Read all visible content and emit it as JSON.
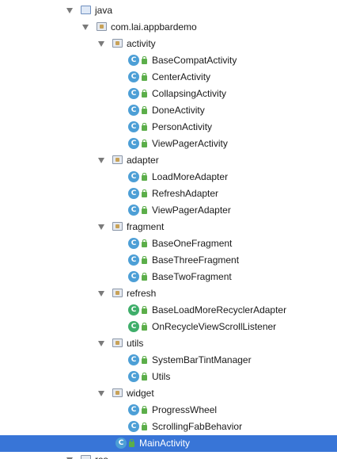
{
  "tree": [
    {
      "label": "java",
      "kind": "source-folder",
      "level": 0,
      "expanded": true
    },
    {
      "label": "com.lai.appbardemo",
      "kind": "package",
      "level": 1,
      "expanded": true
    },
    {
      "label": "activity",
      "kind": "package",
      "level": 2,
      "expanded": true
    },
    {
      "label": "BaseCompatActivity",
      "kind": "class",
      "level": 3
    },
    {
      "label": "CenterActivity",
      "kind": "class",
      "level": 3
    },
    {
      "label": "CollapsingActivity",
      "kind": "class",
      "level": 3
    },
    {
      "label": "DoneActivity",
      "kind": "class",
      "level": 3
    },
    {
      "label": "PersonActivity",
      "kind": "class",
      "level": 3
    },
    {
      "label": "ViewPagerActivity",
      "kind": "class",
      "level": 3
    },
    {
      "label": "adapter",
      "kind": "package",
      "level": 2,
      "expanded": true
    },
    {
      "label": "LoadMoreAdapter",
      "kind": "class",
      "level": 3
    },
    {
      "label": "RefreshAdapter",
      "kind": "class",
      "level": 3
    },
    {
      "label": "ViewPagerAdapter",
      "kind": "class",
      "level": 3
    },
    {
      "label": "fragment",
      "kind": "package",
      "level": 2,
      "expanded": true
    },
    {
      "label": "BaseOneFragment",
      "kind": "class",
      "level": 3
    },
    {
      "label": "BaseThreeFragment",
      "kind": "class",
      "level": 3
    },
    {
      "label": "BaseTwoFragment",
      "kind": "class",
      "level": 3
    },
    {
      "label": "refresh",
      "kind": "package",
      "level": 2,
      "expanded": true
    },
    {
      "label": "BaseLoadMoreRecyclerAdapter",
      "kind": "class-green",
      "level": 3
    },
    {
      "label": "OnRecycleViewScrollListener",
      "kind": "class-green",
      "level": 3
    },
    {
      "label": "utils",
      "kind": "package",
      "level": 2,
      "expanded": true
    },
    {
      "label": "SystemBarTintManager",
      "kind": "class",
      "level": 3
    },
    {
      "label": "Utils",
      "kind": "class",
      "level": 3
    },
    {
      "label": "widget",
      "kind": "package",
      "level": 2,
      "expanded": true
    },
    {
      "label": "ProgressWheel",
      "kind": "class",
      "level": 3
    },
    {
      "label": "ScrollingFabBehavior",
      "kind": "class",
      "level": 3
    },
    {
      "label": "MainActivity",
      "kind": "class",
      "level": 2,
      "selected": true
    },
    {
      "label": "res",
      "kind": "folder",
      "level": 0,
      "expanded": true
    }
  ],
  "icon_glyphs": {
    "class": "C"
  },
  "colors": {
    "selection": "#3875d7",
    "class_icon": "#4d9fd6",
    "lock": "#5cae4a"
  }
}
